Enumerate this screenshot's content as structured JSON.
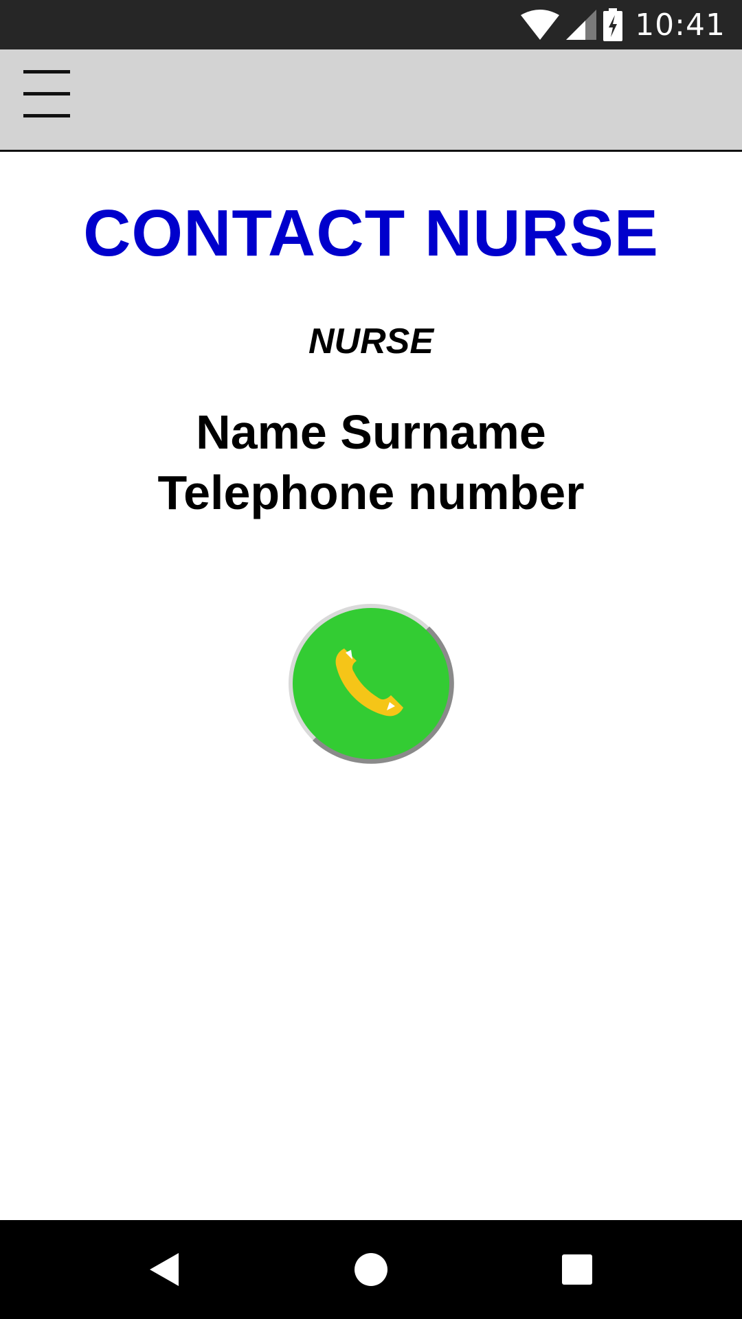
{
  "status_bar": {
    "time": "10:41",
    "icons": [
      "wifi-icon",
      "cell-signal-icon",
      "battery-charging-icon"
    ]
  },
  "app_bar": {
    "menu_icon": "hamburger-menu-icon"
  },
  "content": {
    "title": "CONTACT NURSE",
    "role": "NURSE",
    "name": "Name Surname",
    "phone": "Telephone number",
    "call_icon": "phone-handset-icon"
  },
  "nav_bar": {
    "icons": [
      "back-icon",
      "home-icon",
      "recents-icon"
    ]
  },
  "colors": {
    "title": "#0000cc",
    "app_bar": "#d3d3d3",
    "status_bar": "#262626",
    "call_button": "#33cc33",
    "handset": "#f5c518"
  }
}
